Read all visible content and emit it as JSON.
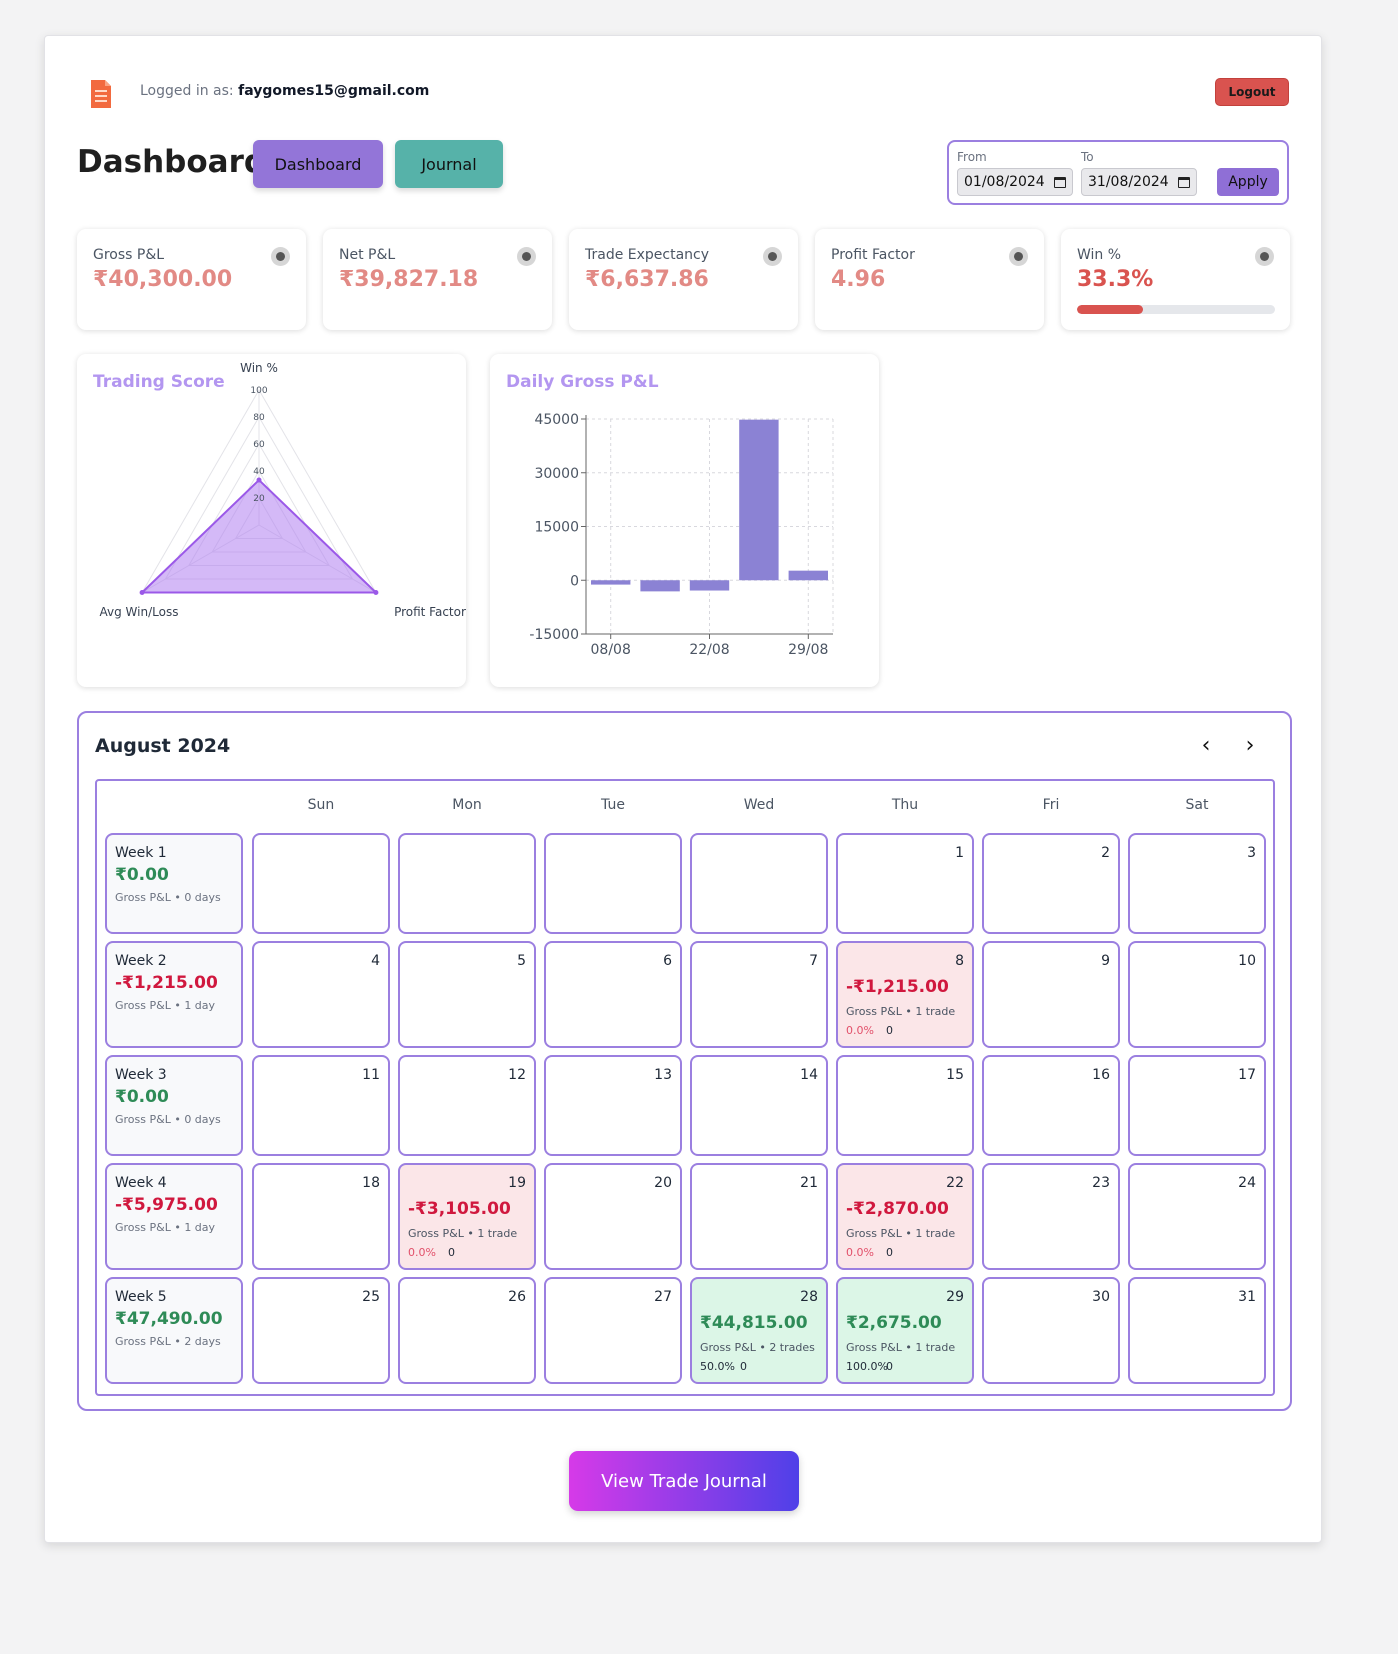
{
  "header": {
    "login_prefix": "Logged in as:",
    "user_email": "faygomes15@gmail.com",
    "logout_label": "Logout"
  },
  "title": "Dashboard",
  "nav": {
    "dashboard_label": "Dashboard",
    "journal_label": "Journal"
  },
  "date_range": {
    "from_label": "From",
    "from_value": "01/08/2024",
    "to_label": "To",
    "to_value": "31/08/2024",
    "apply_label": "Apply"
  },
  "stats": [
    {
      "label": "Gross P&L",
      "value": "₹40,300.00"
    },
    {
      "label": "Net P&L",
      "value": "₹39,827.18"
    },
    {
      "label": "Trade Expectancy",
      "value": "₹6,637.86"
    },
    {
      "label": "Profit Factor",
      "value": "4.96"
    },
    {
      "label": "Win %",
      "value": "33.3%",
      "progress_percent": 33.3
    }
  ],
  "colors": {
    "accent": "#9b7fe0",
    "loss": "#d0183e",
    "profit": "#2e8b57",
    "bar": "#8b82d4"
  },
  "charts": {
    "radar_title": "Trading Score",
    "bar_title": "Daily Gross P&L"
  },
  "chart_data": [
    {
      "type": "radar",
      "title": "Trading Score",
      "axes": [
        "Win %",
        "Profit Factor",
        "Avg Win/Loss"
      ],
      "values": [
        33.3,
        100,
        100
      ],
      "ticks": [
        20,
        40,
        60,
        80,
        100
      ],
      "range": [
        0,
        100
      ]
    },
    {
      "type": "bar",
      "title": "Daily Gross P&L",
      "categories": [
        "08/08",
        "19/08",
        "22/08",
        "28/08",
        "29/08"
      ],
      "values": [
        -1215,
        -3105,
        -2870,
        44815,
        2675
      ],
      "x_tick_labels": [
        "08/08",
        "22/08",
        "29/08"
      ],
      "y_ticks": [
        -15000,
        0,
        15000,
        30000,
        45000
      ],
      "ylim": [
        -15000,
        45000
      ],
      "grid": true
    }
  ],
  "calendar": {
    "month_title": "August 2024",
    "prev_icon": "‹",
    "next_icon": "›",
    "weekdays": [
      "Sun",
      "Mon",
      "Tue",
      "Wed",
      "Thu",
      "Fri",
      "Sat"
    ],
    "weeks": [
      {
        "label": "Week 1",
        "pnl": "₹0.00",
        "sign": "pos",
        "sub": "Gross P&L • 0 days",
        "days": [
          {
            "num": ""
          },
          {
            "num": ""
          },
          {
            "num": ""
          },
          {
            "num": ""
          },
          {
            "num": "1"
          },
          {
            "num": "2"
          },
          {
            "num": "3"
          }
        ]
      },
      {
        "label": "Week 2",
        "pnl": "-₹1,215.00",
        "sign": "neg",
        "sub": "Gross P&L • 1 day",
        "days": [
          {
            "num": "4"
          },
          {
            "num": "5"
          },
          {
            "num": "6"
          },
          {
            "num": "7"
          },
          {
            "num": "8",
            "pnl": "-₹1,215.00",
            "sign": "neg",
            "sub": "Gross P&L • 1 trade",
            "winrate": "0.0%",
            "count": "0"
          },
          {
            "num": "9"
          },
          {
            "num": "10"
          }
        ]
      },
      {
        "label": "Week 3",
        "pnl": "₹0.00",
        "sign": "pos",
        "sub": "Gross P&L • 0 days",
        "days": [
          {
            "num": "11"
          },
          {
            "num": "12"
          },
          {
            "num": "13"
          },
          {
            "num": "14"
          },
          {
            "num": "15"
          },
          {
            "num": "16"
          },
          {
            "num": "17"
          }
        ]
      },
      {
        "label": "Week 4",
        "pnl": "-₹5,975.00",
        "sign": "neg",
        "sub": "Gross P&L • 1 day",
        "days": [
          {
            "num": "18"
          },
          {
            "num": "19",
            "pnl": "-₹3,105.00",
            "sign": "neg",
            "sub": "Gross P&L • 1 trade",
            "winrate": "0.0%",
            "count": "0"
          },
          {
            "num": "20"
          },
          {
            "num": "21"
          },
          {
            "num": "22",
            "pnl": "-₹2,870.00",
            "sign": "neg",
            "sub": "Gross P&L • 1 trade",
            "winrate": "0.0%",
            "count": "0"
          },
          {
            "num": "23"
          },
          {
            "num": "24"
          }
        ]
      },
      {
        "label": "Week 5",
        "pnl": "₹47,490.00",
        "sign": "pos",
        "sub": "Gross P&L • 2 days",
        "days": [
          {
            "num": "25"
          },
          {
            "num": "26"
          },
          {
            "num": "27"
          },
          {
            "num": "28",
            "pnl": "₹44,815.00",
            "sign": "pos",
            "sub": "Gross P&L • 2 trades",
            "winrate": "50.0%",
            "count": "0"
          },
          {
            "num": "29",
            "pnl": "₹2,675.00",
            "sign": "pos",
            "sub": "Gross P&L • 1 trade",
            "winrate": "100.0%",
            "count": "0"
          },
          {
            "num": "30"
          },
          {
            "num": "31"
          }
        ]
      }
    ]
  },
  "footer": {
    "journal_button_label": "View Trade Journal"
  }
}
